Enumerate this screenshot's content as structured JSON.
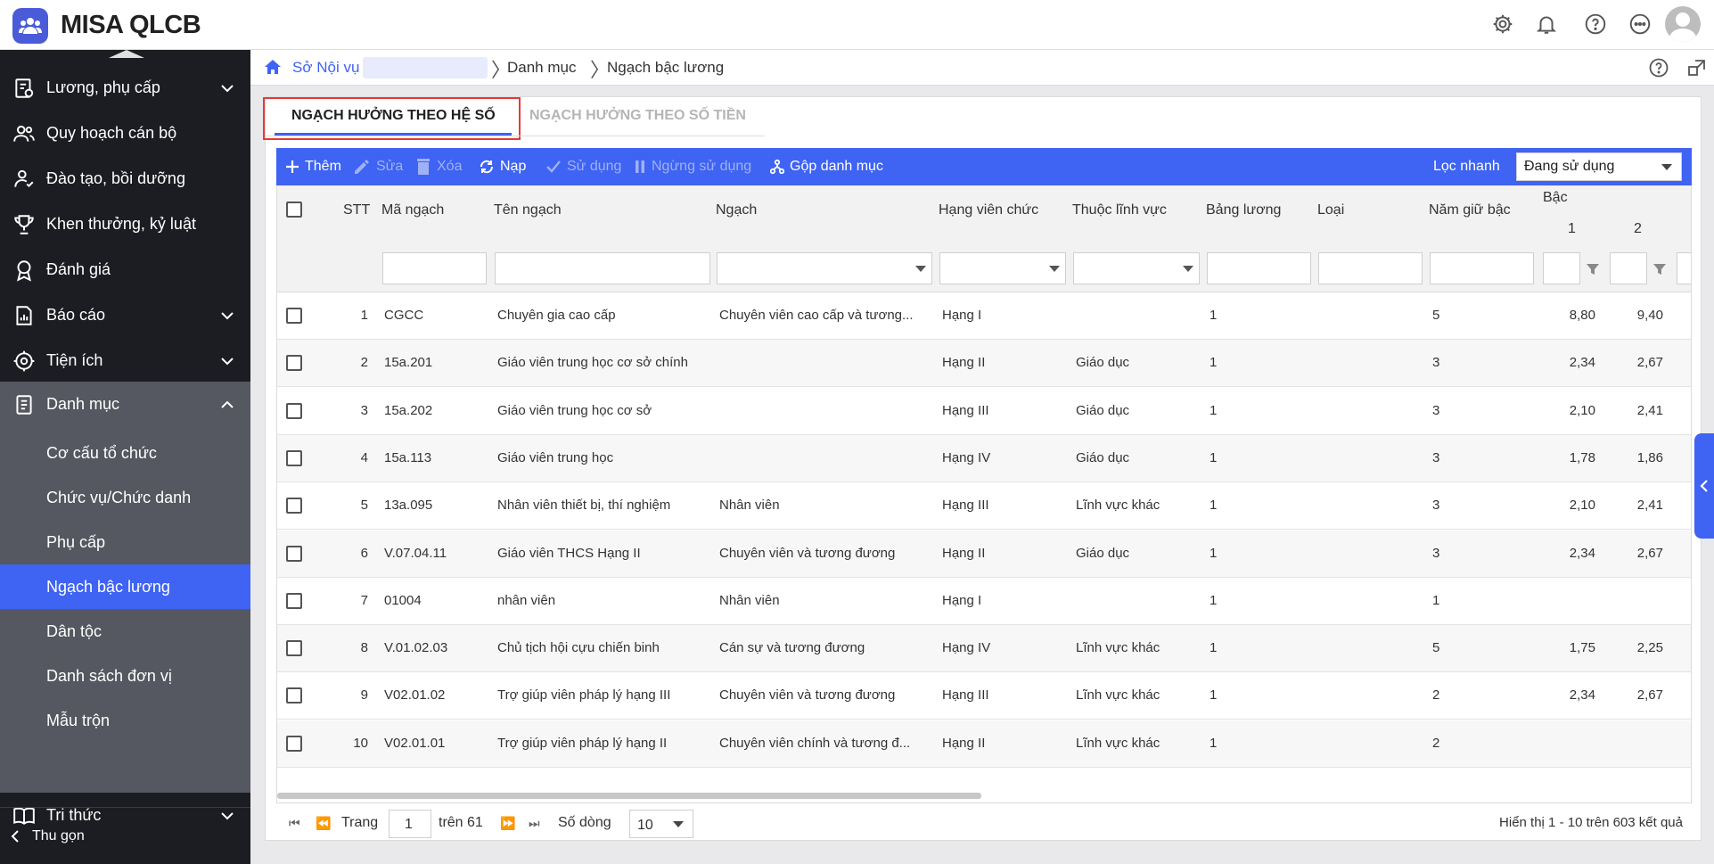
{
  "app": {
    "title": "MISA QLCB"
  },
  "sidebar": {
    "items": [
      {
        "label": "Lương, phụ cấp",
        "icon": "salary-icon"
      },
      {
        "label": "Quy hoạch cán bộ",
        "icon": "people-icon"
      },
      {
        "label": "Đào tạo, bồi dưỡng",
        "icon": "training-icon"
      },
      {
        "label": "Khen thưởng, kỷ luật",
        "icon": "trophy-icon"
      },
      {
        "label": "Đánh giá",
        "icon": "badge-icon"
      },
      {
        "label": "Báo cáo",
        "icon": "report-icon"
      },
      {
        "label": "Tiện ích",
        "icon": "gear-icon"
      },
      {
        "label": "Danh mục",
        "icon": "document-icon"
      },
      {
        "label": "Tri thức",
        "icon": "book-icon"
      }
    ],
    "subitems": [
      "Cơ cấu tổ chức",
      "Chức vụ/Chức danh",
      "Phụ cấp",
      "Ngạch bậc lương",
      "Dân tộc",
      "Danh sách đơn vị",
      "Mẫu trộn"
    ],
    "collapse_label": "Thu gọn"
  },
  "breadcrumb": {
    "root": "Sở Nội vụ",
    "level2": "Danh mục",
    "current": "Ngạch bậc lương"
  },
  "tabs": [
    "NGẠCH HƯỞNG THEO HỆ SỐ",
    "NGẠCH HƯỞNG THEO SỐ TIỀN"
  ],
  "toolbar": {
    "add": "Thêm",
    "edit": "Sửa",
    "delete": "Xóa",
    "reload": "Nạp",
    "use": "Sử dụng",
    "stop": "Ngừng sử dụng",
    "merge": "Gộp danh mục",
    "filter_label": "Lọc nhanh",
    "filter_value": "Đang sử dụng"
  },
  "columns": {
    "stt": "STT",
    "code": "Mã ngạch",
    "name": "Tên ngạch",
    "rank": "Ngạch",
    "grade": "Hạng viên chức",
    "field": "Thuộc lĩnh vực",
    "table": "Bảng lương",
    "type": "Loại",
    "years": "Năm giữ bậc",
    "level": "Bậc",
    "level1": "1",
    "level2": "2"
  },
  "rows": [
    {
      "stt": "1",
      "code": "CGCC",
      "name": "Chuyên gia cao cấp",
      "rank": "Chuyên viên cao cấp và tương...",
      "grade": "Hạng I",
      "field": "",
      "table": "1",
      "years": "5",
      "l1": "8,80",
      "l2": "9,40"
    },
    {
      "stt": "2",
      "code": "15a.201",
      "name": "Giáo viên trung học cơ sở chính",
      "rank": "",
      "grade": "Hạng II",
      "field": "Giáo dục",
      "table": "1",
      "years": "3",
      "l1": "2,34",
      "l2": "2,67"
    },
    {
      "stt": "3",
      "code": "15a.202",
      "name": "Giáo viên trung học cơ sở",
      "rank": "",
      "grade": "Hạng III",
      "field": "Giáo dục",
      "table": "1",
      "years": "3",
      "l1": "2,10",
      "l2": "2,41"
    },
    {
      "stt": "4",
      "code": "15a.113",
      "name": "Giáo viên trung học",
      "rank": "",
      "grade": "Hạng IV",
      "field": "Giáo dục",
      "table": "1",
      "years": "3",
      "l1": "1,78",
      "l2": "1,86"
    },
    {
      "stt": "5",
      "code": "13a.095",
      "name": "Nhân viên thiết bị, thí nghiệm",
      "rank": "Nhân viên",
      "grade": "Hạng III",
      "field": "Lĩnh vực khác",
      "table": "1",
      "years": "3",
      "l1": "2,10",
      "l2": "2,41"
    },
    {
      "stt": "6",
      "code": "V.07.04.11",
      "name": "Giáo viên THCS Hạng II",
      "rank": "Chuyên viên và tương đương",
      "grade": "Hạng II",
      "field": "Giáo dục",
      "table": "1",
      "years": "3",
      "l1": "2,34",
      "l2": "2,67"
    },
    {
      "stt": "7",
      "code": "01004",
      "name": "nhân viên",
      "rank": "Nhân viên",
      "grade": "Hạng I",
      "field": "",
      "table": "1",
      "years": "1",
      "l1": "",
      "l2": ""
    },
    {
      "stt": "8",
      "code": "V.01.02.03",
      "name": "Chủ tịch hội cựu chiến binh",
      "rank": "Cán sự và tương đương",
      "grade": "Hạng IV",
      "field": "Lĩnh vực khác",
      "table": "1",
      "years": "5",
      "l1": "1,75",
      "l2": "2,25"
    },
    {
      "stt": "9",
      "code": "V02.01.02",
      "name": "Trợ giúp viên pháp lý hạng III",
      "rank": "Chuyên viên và tương đương",
      "grade": "Hạng III",
      "field": "Lĩnh vực khác",
      "table": "1",
      "years": "2",
      "l1": "2,34",
      "l2": "2,67"
    },
    {
      "stt": "10",
      "code": "V02.01.01",
      "name": "Trợ giúp viên pháp lý hạng II",
      "rank": "Chuyên viên chính và tương đ...",
      "grade": "Hạng II",
      "field": "Lĩnh vực khác",
      "table": "1",
      "years": "2",
      "l1": "",
      "l2": ""
    }
  ],
  "pager": {
    "page_label": "Trang",
    "page": "1",
    "of_label": "trên 61",
    "rows_label": "Số dòng",
    "rows_value": "10",
    "summary": "Hiển thị 1 - 10 trên 603 kết quả"
  },
  "colors": {
    "accent": "#3f63f2",
    "sidebar": "#1c1d22",
    "sub": "#555860"
  }
}
